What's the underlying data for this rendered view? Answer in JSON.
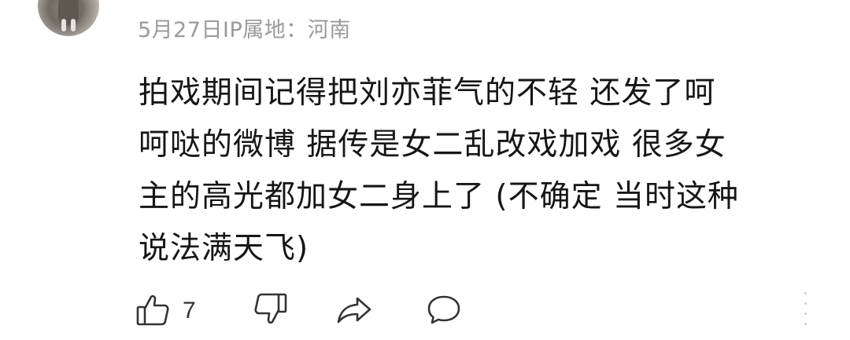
{
  "comment": {
    "meta": {
      "date": "5月27日",
      "ip_label": "IP属地：",
      "ip_location": "河南"
    },
    "lines": [
      "拍戏期间记得把刘亦菲气的不轻 还发了呵",
      "呵哒的微博 据传是女二乱改戏加戏 很多女",
      "主的高光都加女二身上了 (不确定 当时这种",
      "说法满天飞)"
    ],
    "actions": {
      "like_icon": "thumbs-up-icon",
      "like_count": "7",
      "dislike_icon": "thumbs-down-icon",
      "share_icon": "share-arrow-icon",
      "reply_icon": "comment-bubble-icon"
    }
  }
}
